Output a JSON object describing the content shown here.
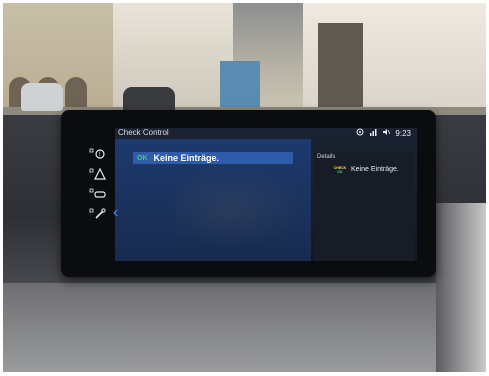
{
  "screen": {
    "title": "Check Control",
    "status": {
      "media_icon": "media-target-icon",
      "phone_icon": "phone-signal-icon",
      "mute_icon": "speaker-mute-icon",
      "time": "9:23"
    },
    "list": {
      "rows": [
        {
          "status": "OK",
          "label": "Keine Einträge."
        }
      ],
      "back_icon": "chevron-left-icon"
    },
    "details": {
      "title": "Details",
      "badge_top": "CHECK",
      "badge_bottom": "OK",
      "text": "Keine Einträge."
    },
    "side_icons": [
      "brake-warning-icon",
      "triangle-warning-icon",
      "car-service-icon",
      "wrench-service-icon"
    ]
  },
  "colors": {
    "panel_blue": "#1d3a6e",
    "highlight_blue": "#2f5bab",
    "ok_green": "#3fd06a",
    "badge_yellow": "#ffe048"
  }
}
